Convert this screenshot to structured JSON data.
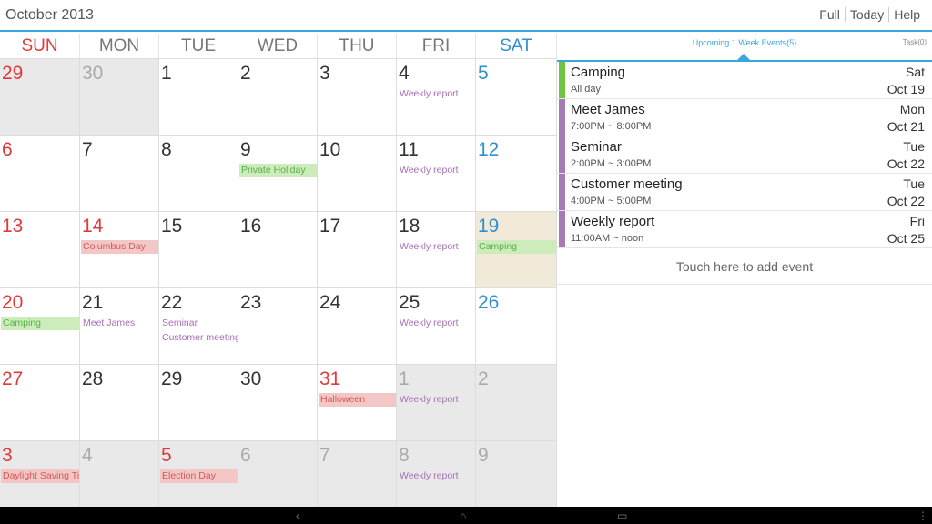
{
  "header": {
    "month_title": "October 2013",
    "actions": [
      "Full",
      "Today",
      "Help"
    ]
  },
  "calendar": {
    "weekdays": [
      "SUN",
      "MON",
      "TUE",
      "WED",
      "THU",
      "FRI",
      "SAT"
    ],
    "weeks": [
      [
        {
          "day": "29",
          "other": true,
          "events": []
        },
        {
          "day": "30",
          "other": true,
          "events": []
        },
        {
          "day": "1",
          "events": []
        },
        {
          "day": "2",
          "events": []
        },
        {
          "day": "3",
          "events": []
        },
        {
          "day": "4",
          "events": [
            {
              "label": "Weekly report",
              "style": "plain"
            }
          ]
        },
        {
          "day": "5",
          "events": []
        }
      ],
      [
        {
          "day": "6",
          "events": []
        },
        {
          "day": "7",
          "events": []
        },
        {
          "day": "8",
          "events": []
        },
        {
          "day": "9",
          "events": [
            {
              "label": "Private Holiday",
              "style": "green"
            }
          ]
        },
        {
          "day": "10",
          "events": []
        },
        {
          "day": "11",
          "events": [
            {
              "label": "Weekly report",
              "style": "plain"
            }
          ]
        },
        {
          "day": "12",
          "events": []
        }
      ],
      [
        {
          "day": "13",
          "events": []
        },
        {
          "day": "14",
          "holiday": true,
          "events": [
            {
              "label": "Columbus Day",
              "style": "red"
            }
          ]
        },
        {
          "day": "15",
          "events": []
        },
        {
          "day": "16",
          "events": []
        },
        {
          "day": "17",
          "events": []
        },
        {
          "day": "18",
          "events": [
            {
              "label": "Weekly report",
              "style": "plain"
            }
          ]
        },
        {
          "day": "19",
          "today": true,
          "events": [
            {
              "label": "Camping",
              "style": "green"
            }
          ]
        }
      ],
      [
        {
          "day": "20",
          "events": [
            {
              "label": "Camping",
              "style": "green"
            }
          ]
        },
        {
          "day": "21",
          "events": [
            {
              "label": "Meet James",
              "style": "plain"
            }
          ]
        },
        {
          "day": "22",
          "events": [
            {
              "label": "Seminar",
              "style": "plain"
            },
            {
              "label": "Customer meeting",
              "style": "plain"
            }
          ]
        },
        {
          "day": "23",
          "events": []
        },
        {
          "day": "24",
          "events": []
        },
        {
          "day": "25",
          "events": [
            {
              "label": "Weekly report",
              "style": "plain"
            }
          ]
        },
        {
          "day": "26",
          "events": []
        }
      ],
      [
        {
          "day": "27",
          "events": []
        },
        {
          "day": "28",
          "events": []
        },
        {
          "day": "29",
          "events": []
        },
        {
          "day": "30",
          "events": []
        },
        {
          "day": "31",
          "holiday": true,
          "events": [
            {
              "label": "Halloween",
              "style": "red"
            }
          ]
        },
        {
          "day": "1",
          "other": true,
          "events": [
            {
              "label": "Weekly report",
              "style": "plain"
            }
          ]
        },
        {
          "day": "2",
          "other": true,
          "events": []
        }
      ],
      [
        {
          "day": "3",
          "other": true,
          "events": [
            {
              "label": "Daylight Saving Time",
              "style": "red"
            }
          ]
        },
        {
          "day": "4",
          "other": true,
          "events": []
        },
        {
          "day": "5",
          "other": true,
          "holiday": true,
          "events": [
            {
              "label": "Election Day",
              "style": "red"
            }
          ]
        },
        {
          "day": "6",
          "other": true,
          "events": []
        },
        {
          "day": "7",
          "other": true,
          "events": []
        },
        {
          "day": "8",
          "other": true,
          "events": [
            {
              "label": "Weekly report",
              "style": "plain"
            }
          ]
        },
        {
          "day": "9",
          "other": true,
          "events": []
        }
      ]
    ]
  },
  "panel": {
    "title": "Upcoming 1 Week Events(5)",
    "task_label": "Task(0)",
    "events": [
      {
        "name": "Camping",
        "time": "All day",
        "dow": "Sat",
        "date": "Oct 19",
        "color": "#6cc644"
      },
      {
        "name": "Meet James",
        "time": "7:00PM ~ 8:00PM",
        "dow": "Mon",
        "date": "Oct 21",
        "color": "#a57ab5"
      },
      {
        "name": "Seminar",
        "time": "2:00PM ~ 3:00PM",
        "dow": "Tue",
        "date": "Oct 22",
        "color": "#a57ab5"
      },
      {
        "name": "Customer meeting",
        "time": "4:00PM ~ 5:00PM",
        "dow": "Tue",
        "date": "Oct 22",
        "color": "#a57ab5"
      },
      {
        "name": "Weekly report",
        "time": "11:00AM ~ noon",
        "dow": "Fri",
        "date": "Oct 25",
        "color": "#a57ab5"
      }
    ],
    "add_event_label": "Touch here to add event"
  },
  "navbar": {
    "icons": [
      "back-icon",
      "home-icon",
      "recents-icon",
      "menu-icon"
    ]
  }
}
